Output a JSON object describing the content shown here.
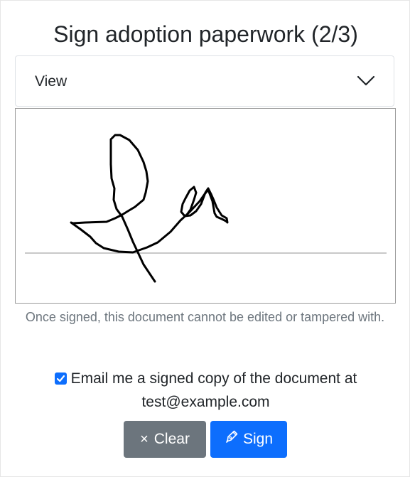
{
  "page": {
    "title": "Sign adoption paperwork (2/3)"
  },
  "view_select": {
    "label": "View",
    "icon": "chevron-down-icon"
  },
  "signature_pad": {
    "has_signature": true
  },
  "notice": {
    "text": "Once signed, this document cannot be edited or tampered with."
  },
  "email_option": {
    "checked": true,
    "text": "Email me a signed copy of the document at test@example.com"
  },
  "actions": {
    "clear_icon": "×",
    "clear_label": "Clear",
    "sign_label": "Sign",
    "sign_icon": "pen-icon"
  },
  "colors": {
    "primary": "#0d6efd",
    "secondary": "#6c757d",
    "muted_text": "#6c757d"
  }
}
